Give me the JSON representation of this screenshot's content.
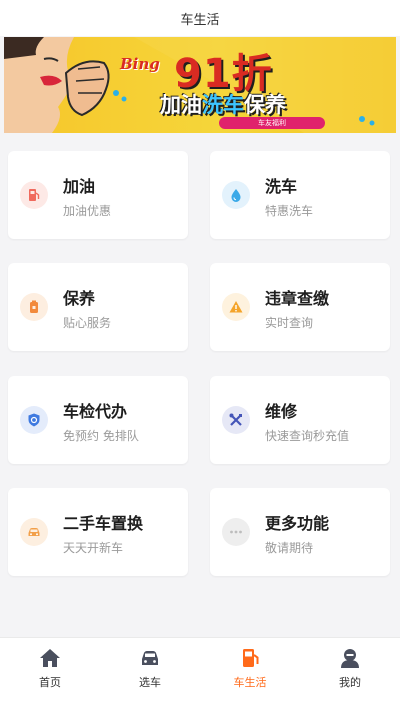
{
  "header": {
    "title": "车生活"
  },
  "banner": {
    "brand": "Bing",
    "headline": "91折",
    "subtitle_a": "加油",
    "subtitle_b": "洗车",
    "subtitle_c": "保养",
    "pill_label": "车友福利"
  },
  "services": [
    {
      "title": "加油",
      "subtitle": "加油优惠",
      "icon": "fuel-pump-icon",
      "color": "#f06a5e",
      "bg": "#fde9e6"
    },
    {
      "title": "洗车",
      "subtitle": "特惠洗车",
      "icon": "water-drop-icon",
      "color": "#3aa9e8",
      "bg": "#e3f2fc"
    },
    {
      "title": "保养",
      "subtitle": "贴心服务",
      "icon": "oil-can-icon",
      "color": "#f28a3c",
      "bg": "#fdeee0"
    },
    {
      "title": "违章查缴",
      "subtitle": "实时查询",
      "icon": "warning-icon",
      "color": "#f4a42a",
      "bg": "#fef2de"
    },
    {
      "title": "车检代办",
      "subtitle": "免预约 免排队",
      "icon": "shield-icon",
      "color": "#3f7ae0",
      "bg": "#e4ecfb"
    },
    {
      "title": "维修",
      "subtitle": "快速查询秒充值",
      "icon": "tools-icon",
      "color": "#4455b8",
      "bg": "#e6e8f6"
    },
    {
      "title": "二手车置换",
      "subtitle": "天天开新车",
      "icon": "car-icon",
      "color": "#f2a04a",
      "bg": "#fdefe0"
    },
    {
      "title": "更多功能",
      "subtitle": "敬请期待",
      "icon": "more-dots-icon",
      "color": "#bdbdbd",
      "bg": "#eeeeee"
    }
  ],
  "nav": [
    {
      "label": "首页",
      "icon": "home-icon"
    },
    {
      "label": "选车",
      "icon": "car-front-icon"
    },
    {
      "label": "车生活",
      "icon": "fuel-station-icon",
      "active": true
    },
    {
      "label": "我的",
      "icon": "user-icon"
    }
  ],
  "colors": {
    "accent": "#ff6a1a",
    "nav_icon": "#4a4f5e"
  }
}
